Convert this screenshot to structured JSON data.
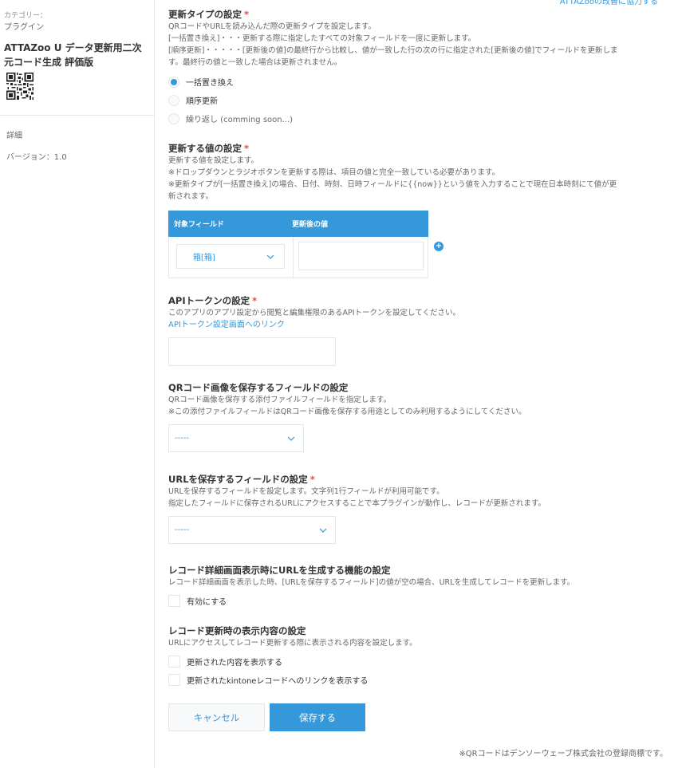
{
  "top_link": "ATTAZooの改善に協力する",
  "sidebar": {
    "category_label": "カテゴリー：",
    "category_value": "プラグイン",
    "title": "ATTAZoo U データ更新用二次元コード生成 評価版",
    "detail": "詳細",
    "version": "バージョン：1.0"
  },
  "update_type": {
    "title": "更新タイプの設定",
    "required_mark": "*",
    "desc": [
      "QRコードやURLを読み込んだ際の更新タイプを設定します。",
      "[一括置き換え]・・・更新する際に指定したすべての対象フィールドを一度に更新します。",
      "[順序更新]・・・・・[更新後の値]の最終行から比較し、値が一致した行の次の行に指定された[更新後の値]でフィールドを更新しま",
      "す。最終行の値と一致した場合は更新されません。"
    ],
    "options": [
      "一括置き換え",
      "順序更新",
      "繰り返し (comming soon...)"
    ]
  },
  "update_value": {
    "title": "更新する値の設定",
    "required_mark": "*",
    "desc": [
      "更新する値を設定します。",
      "※ドロップダウンとラジオボタンを更新する際は、項目の値と完全一致している必要があります。",
      "※更新タイプが[一括置き換え]の場合、日付、時刻、日時フィールドに{{now}}という値を入力することで現在日本時刻にて値が更",
      "新されます。"
    ],
    "col_field": "対象フィールド",
    "col_value": "更新後の値",
    "field_selected": "箱[箱]",
    "add_symbol": "+"
  },
  "api_token": {
    "title": "APIトークンの設定",
    "required_mark": "*",
    "desc": "このアプリのアプリ設定から閲覧と編集権限のあるAPIトークンを設定してください。",
    "link": "APIトークン設定画面へのリンク"
  },
  "qr_field": {
    "title": "QRコード画像を保存するフィールドの設定",
    "desc": [
      "QRコード画像を保存する添付ファイルフィールドを指定します。",
      "※この添付ファイルフィールドはQRコード画像を保存する用途としてのみ利用するようにしてください。"
    ],
    "selected": "-----"
  },
  "url_field": {
    "title": "URLを保存するフィールドの設定",
    "required_mark": "*",
    "desc": [
      "URLを保存するフィールドを設定します。文字列1行フィールドが利用可能です。",
      "指定したフィールドに保存されるURLにアクセスすることで本プラグインが動作し、レコードが更新されます。"
    ],
    "selected": "-----"
  },
  "record_detail": {
    "title": "レコード詳細画面表示時にURLを生成する機能の設定",
    "desc": "レコード詳細画面を表示した時、[URLを保存するフィールド]の値が空の場合、URLを生成してレコードを更新します。",
    "checkbox": "有効にする"
  },
  "record_update": {
    "title": "レコード更新時の表示内容の設定",
    "desc": "URLにアクセスしてレコード更新する際に表示される内容を設定します。",
    "checkbox1": "更新された内容を表示する",
    "checkbox2": "更新されたkintoneレコードへのリンクを表示する"
  },
  "buttons": {
    "cancel": "キャンセル",
    "save": "保存する"
  },
  "footer_note": "※QRコードはデンソーウェーブ株式会社の登録商標です。",
  "colors": {
    "accent": "#3498db",
    "required": "#e74c3c"
  }
}
